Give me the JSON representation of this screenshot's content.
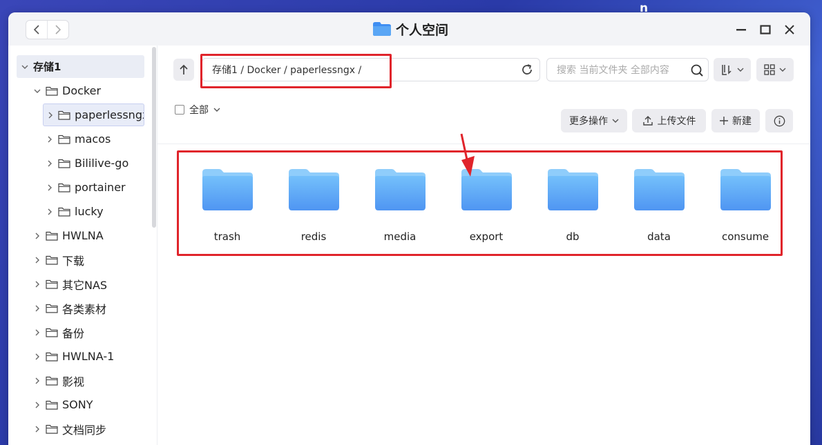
{
  "window": {
    "title": "个人空间"
  },
  "desktop_glyph": "n",
  "sidebar": {
    "root": "存储1",
    "items": [
      {
        "label": "Docker",
        "level": 1,
        "expanded": true
      },
      {
        "label": "paperlessngx",
        "level": 2,
        "selected": true
      },
      {
        "label": "macos",
        "level": 2
      },
      {
        "label": "Bililive-go",
        "level": 2
      },
      {
        "label": "portainer",
        "level": 2
      },
      {
        "label": "lucky",
        "level": 2
      },
      {
        "label": "HWLNA",
        "level": 1
      },
      {
        "label": "下载",
        "level": 1
      },
      {
        "label": "其它NAS",
        "level": 1
      },
      {
        "label": "各类素材",
        "level": 1
      },
      {
        "label": "备份",
        "level": 1
      },
      {
        "label": "HWLNA-1",
        "level": 1
      },
      {
        "label": "影视",
        "level": 1
      },
      {
        "label": "SONY",
        "level": 1
      },
      {
        "label": "文档同步",
        "level": 1
      }
    ]
  },
  "toolbar": {
    "path": "存储1 / Docker / paperlessngx /",
    "search_placeholder": "搜索 当前文件夹 全部内容",
    "select_all_label": "全部",
    "more_actions_label": "更多操作",
    "upload_label": "上传文件",
    "new_label": "新建"
  },
  "files": [
    "trash",
    "redis",
    "media",
    "export",
    "db",
    "data",
    "consume"
  ],
  "colors": {
    "highlight": "#e0242b",
    "folder": "#5aa6f5",
    "accent": "#4a8cf0"
  }
}
